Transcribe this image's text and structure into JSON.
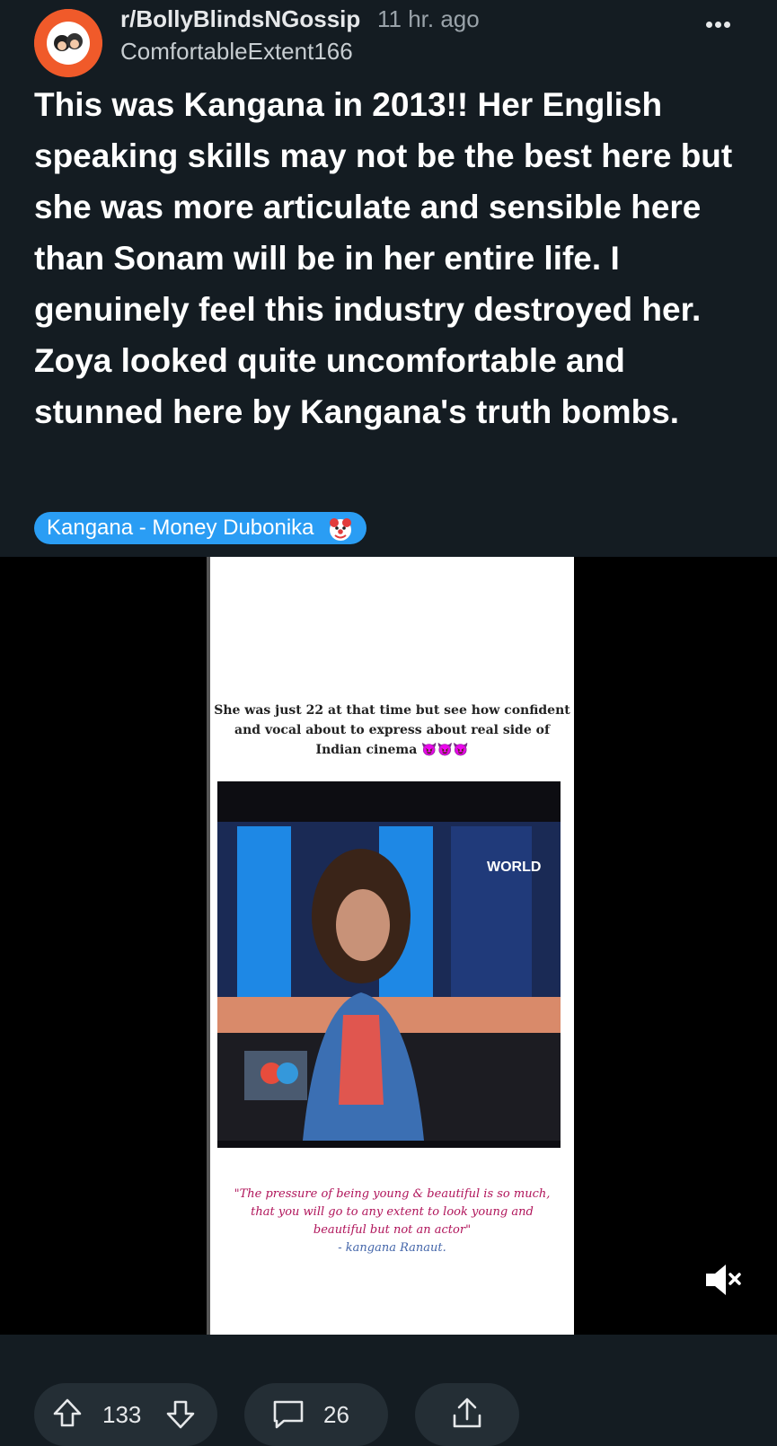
{
  "post": {
    "subreddit": "r/BollyBlindsNGossip",
    "time": "11 hr. ago",
    "author": "ComfortableExtent166",
    "title": "This was Kangana in 2013!! Her English speaking skills may not be the best here but she was more articulate and sensible here than Sonam will be in her entire life. I genuinely feel this industry destroyed her. Zoya looked quite uncomfortable and stunned here by Kangana's truth bombs.",
    "flair": "Kangana - Money Dubonika",
    "icons": {
      "avatar": "bollywood-gossip-avatar",
      "more": "more-options-icon",
      "flair_emoji": "clown-icon",
      "mute": "muted-speaker-icon",
      "upvote": "upvote-arrow-icon",
      "downvote": "downvote-arrow-icon",
      "comment": "comment-bubble-icon",
      "share": "share-icon"
    }
  },
  "media": {
    "caption_top": "She was just 22 at that time but see how confident and vocal about to express about real side of Indian cinema 😈😈😈",
    "video_logo": "WORLD",
    "quote": "\"The pressure of being young & beautiful is so much, that you will go to any extent to look young and beautiful but not an actor\"",
    "quote_by": "- kangana Ranaut."
  },
  "actions": {
    "upvotes": "133",
    "comments": "26"
  },
  "colors": {
    "background": "#141c22",
    "flair": "#2a9df4",
    "pill": "#242e35"
  }
}
